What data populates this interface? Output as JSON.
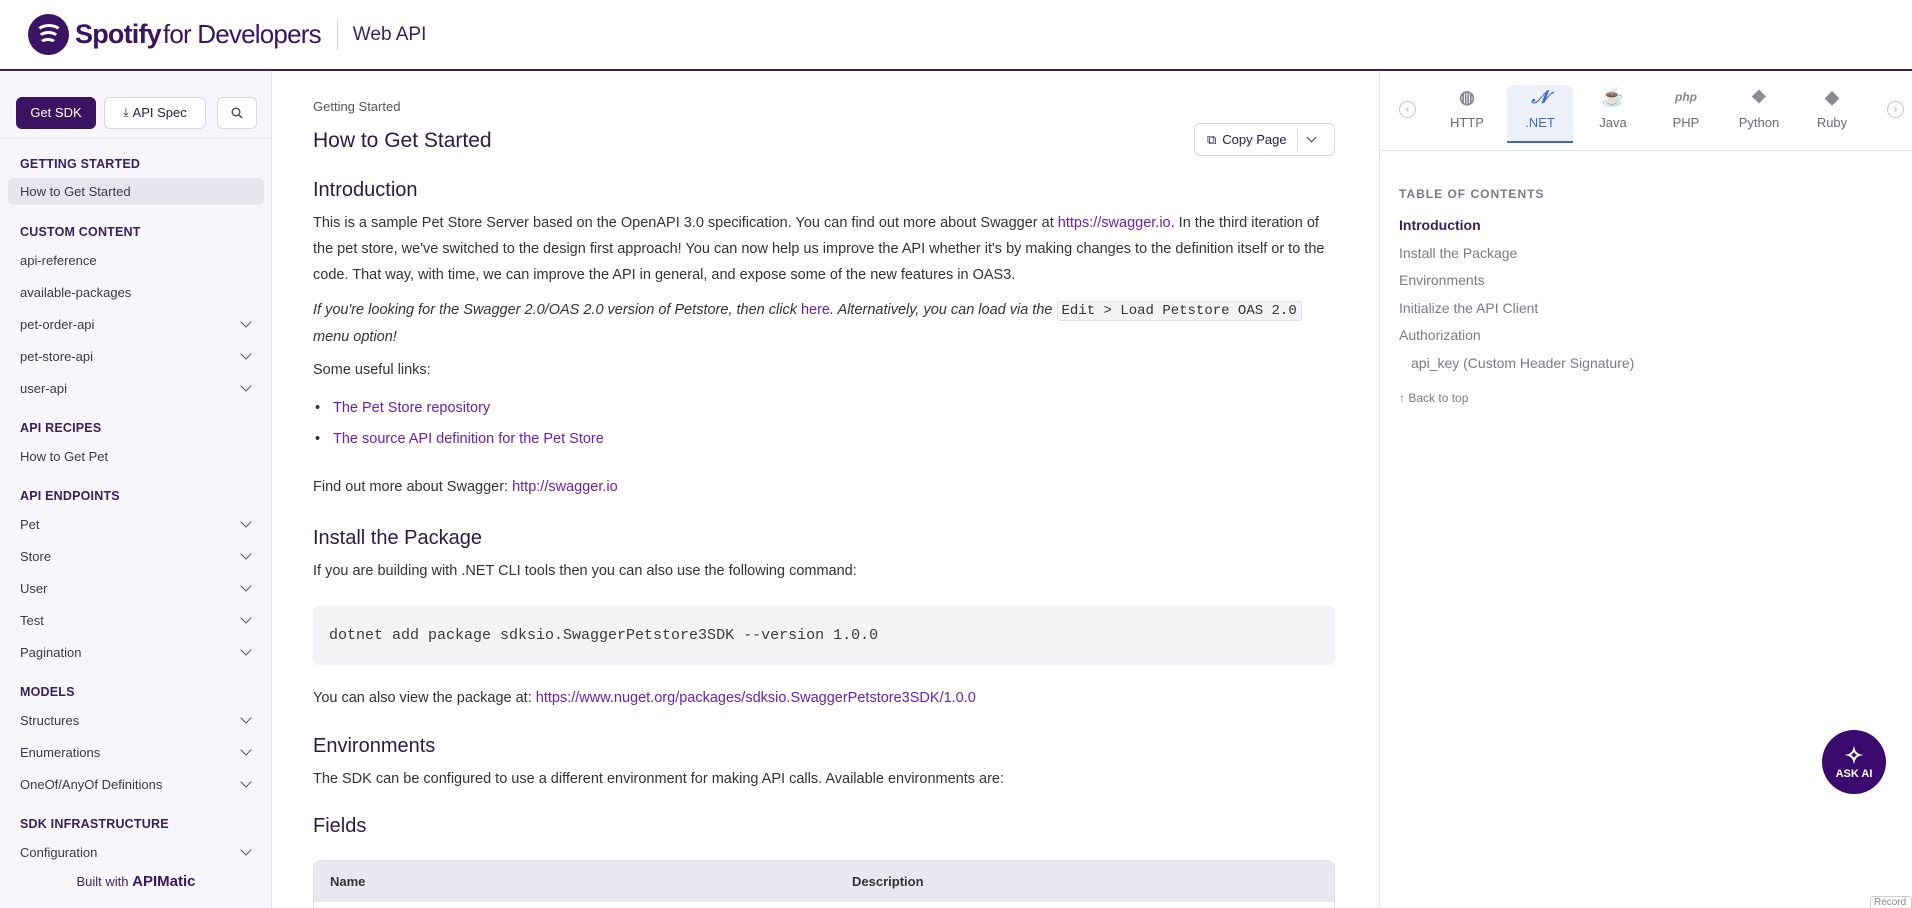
{
  "header": {
    "brand": "Spotify",
    "brand_sub": "for Developers",
    "title": "Web API"
  },
  "sidebar": {
    "get_sdk": "Get SDK",
    "api_spec": "API Spec",
    "search_icon": "search-icon",
    "sections": [
      {
        "heading": "GETTING STARTED",
        "items": [
          {
            "label": "How to Get Started",
            "active": true
          }
        ]
      },
      {
        "heading": "CUSTOM CONTENT",
        "items": [
          {
            "label": "api-reference"
          },
          {
            "label": "available-packages"
          },
          {
            "label": "pet-order-api",
            "expand": true
          },
          {
            "label": "pet-store-api",
            "expand": true
          },
          {
            "label": "user-api",
            "expand": true
          }
        ]
      },
      {
        "heading": "API RECIPES",
        "items": [
          {
            "label": "How to Get Pet"
          }
        ]
      },
      {
        "heading": "API ENDPOINTS",
        "items": [
          {
            "label": "Pet",
            "expand": true
          },
          {
            "label": "Store",
            "expand": true
          },
          {
            "label": "User",
            "expand": true
          },
          {
            "label": "Test",
            "expand": true
          },
          {
            "label": "Pagination",
            "expand": true
          }
        ]
      },
      {
        "heading": "MODELS",
        "items": [
          {
            "label": "Structures",
            "expand": true
          },
          {
            "label": "Enumerations",
            "expand": true
          },
          {
            "label": "OneOf/AnyOf Definitions",
            "expand": true
          }
        ]
      },
      {
        "heading": "SDK INFRASTRUCTURE",
        "items": [
          {
            "label": "Configuration",
            "expand": true
          }
        ]
      }
    ],
    "built_with": "Built with",
    "built_brand": "APIMatic"
  },
  "main": {
    "breadcrumb": "Getting Started",
    "title": "How to Get Started",
    "copy_page": "Copy Page",
    "intro": {
      "heading": "Introduction",
      "p1_a": "This is a sample Pet Store Server based on the OpenAPI 3.0 specification. You can find out more about Swagger at ",
      "p1_link": "https://swagger.io",
      "p1_b": ". In the third iteration of the pet store, we've switched to the design first approach! You can now help us improve the API whether it's by making changes to the definition itself or to the code. That way, with time, we can improve the API in general, and expose some of the new features in OAS3.",
      "p2_a": "If you're looking for the Swagger 2.0/OAS 2.0 version of Petstore, then click ",
      "p2_link": "here",
      "p2_b": ". Alternatively, you can load via the ",
      "p2_code": "Edit > Load Petstore OAS 2.0",
      "p2_c": " menu option!",
      "useful": "Some useful links:",
      "links": [
        "The Pet Store repository",
        "The source API definition for the Pet Store"
      ],
      "more_a": "Find out more about Swagger: ",
      "more_link": "http://swagger.io"
    },
    "install": {
      "heading": "Install the Package",
      "p1": "If you are building with .NET CLI tools then you can also use the following command:",
      "code": "dotnet add package sdksio.SwaggerPetstore3SDK --version 1.0.0",
      "p2_a": "You can also view the package at: ",
      "p2_link": "https://www.nuget.org/packages/sdksio.SwaggerPetstore3SDK/1.0.0"
    },
    "env": {
      "heading": "Environments",
      "p1": "The SDK can be configured to use a different environment for making API calls. Available environments are:"
    },
    "fields": {
      "heading": "Fields",
      "columns": [
        "Name",
        "Description"
      ]
    }
  },
  "right": {
    "languages": [
      {
        "label": "HTTP",
        "icon": "globe-icon"
      },
      {
        "label": ".NET",
        "icon": "dotnet-icon",
        "active": true
      },
      {
        "label": "Java",
        "icon": "java-icon"
      },
      {
        "label": "PHP",
        "icon": "php-icon"
      },
      {
        "label": "Python",
        "icon": "python-icon"
      },
      {
        "label": "Ruby",
        "icon": "ruby-icon"
      }
    ],
    "toc_title": "TABLE OF CONTENTS",
    "toc": [
      {
        "label": "Introduction",
        "active": true
      },
      {
        "label": "Install the Package"
      },
      {
        "label": "Environments"
      },
      {
        "label": "Initialize the API Client"
      },
      {
        "label": "Authorization"
      },
      {
        "label": "api_key (Custom Header Signature)",
        "sub": true
      }
    ],
    "back_to_top": "Back to top",
    "ask_ai": "ASK AI",
    "record": "Record"
  }
}
